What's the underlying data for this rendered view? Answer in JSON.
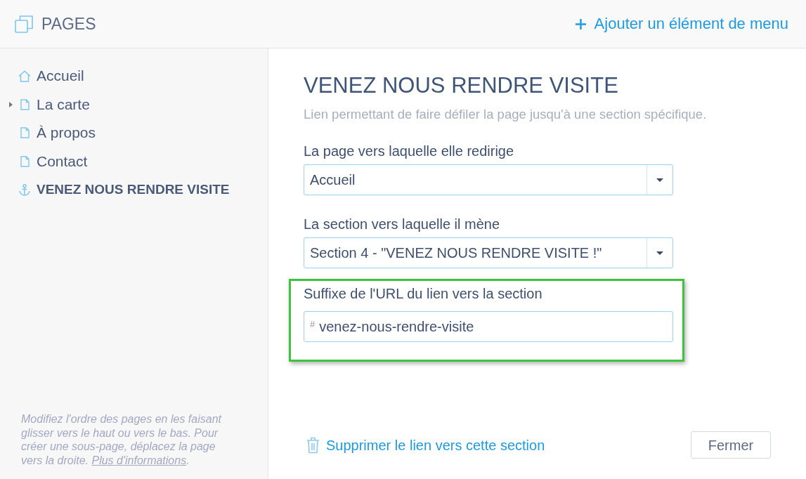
{
  "header": {
    "title": "PAGES",
    "add_button": "Ajouter un élément de menu"
  },
  "sidebar": {
    "items": [
      {
        "label": "Accueil",
        "kind": "home",
        "selected": false
      },
      {
        "label": "La carte",
        "kind": "page",
        "selected": false,
        "expanded": false
      },
      {
        "label": "À propos",
        "kind": "page",
        "selected": false
      },
      {
        "label": "Contact",
        "kind": "page",
        "selected": false
      },
      {
        "label": "VENEZ NOUS RENDRE VISITE",
        "kind": "anchor",
        "selected": true
      }
    ],
    "help": {
      "text": "Modifiez l'ordre des pages en les faisant glisser vers le haut ou vers le bas. Pour créer une sous-page, déplacez la page vers la droite.",
      "link": "Plus d'informations",
      "text_after": "."
    }
  },
  "editor": {
    "title": "VENEZ NOUS RENDRE VISITE",
    "subtitle": "Lien permettant de faire défiler la page jusqu'à une section spécifique.",
    "fields": [
      {
        "kind": "select",
        "label": "La page vers laquelle elle redirige",
        "value": "Accueil",
        "highlighted": false
      },
      {
        "kind": "select",
        "label": "La section vers laquelle il mène",
        "value": "Section 4 - \"VENEZ NOUS RENDRE VISITE !\"",
        "highlighted": false
      },
      {
        "kind": "text",
        "label": "Suffixe de l'URL du lien vers la section",
        "prefix": "#",
        "value": "venez-nous-rendre-visite",
        "highlighted": true
      }
    ],
    "delete_link": "Supprimer le lien vers cette section",
    "close_button": "Fermer"
  }
}
